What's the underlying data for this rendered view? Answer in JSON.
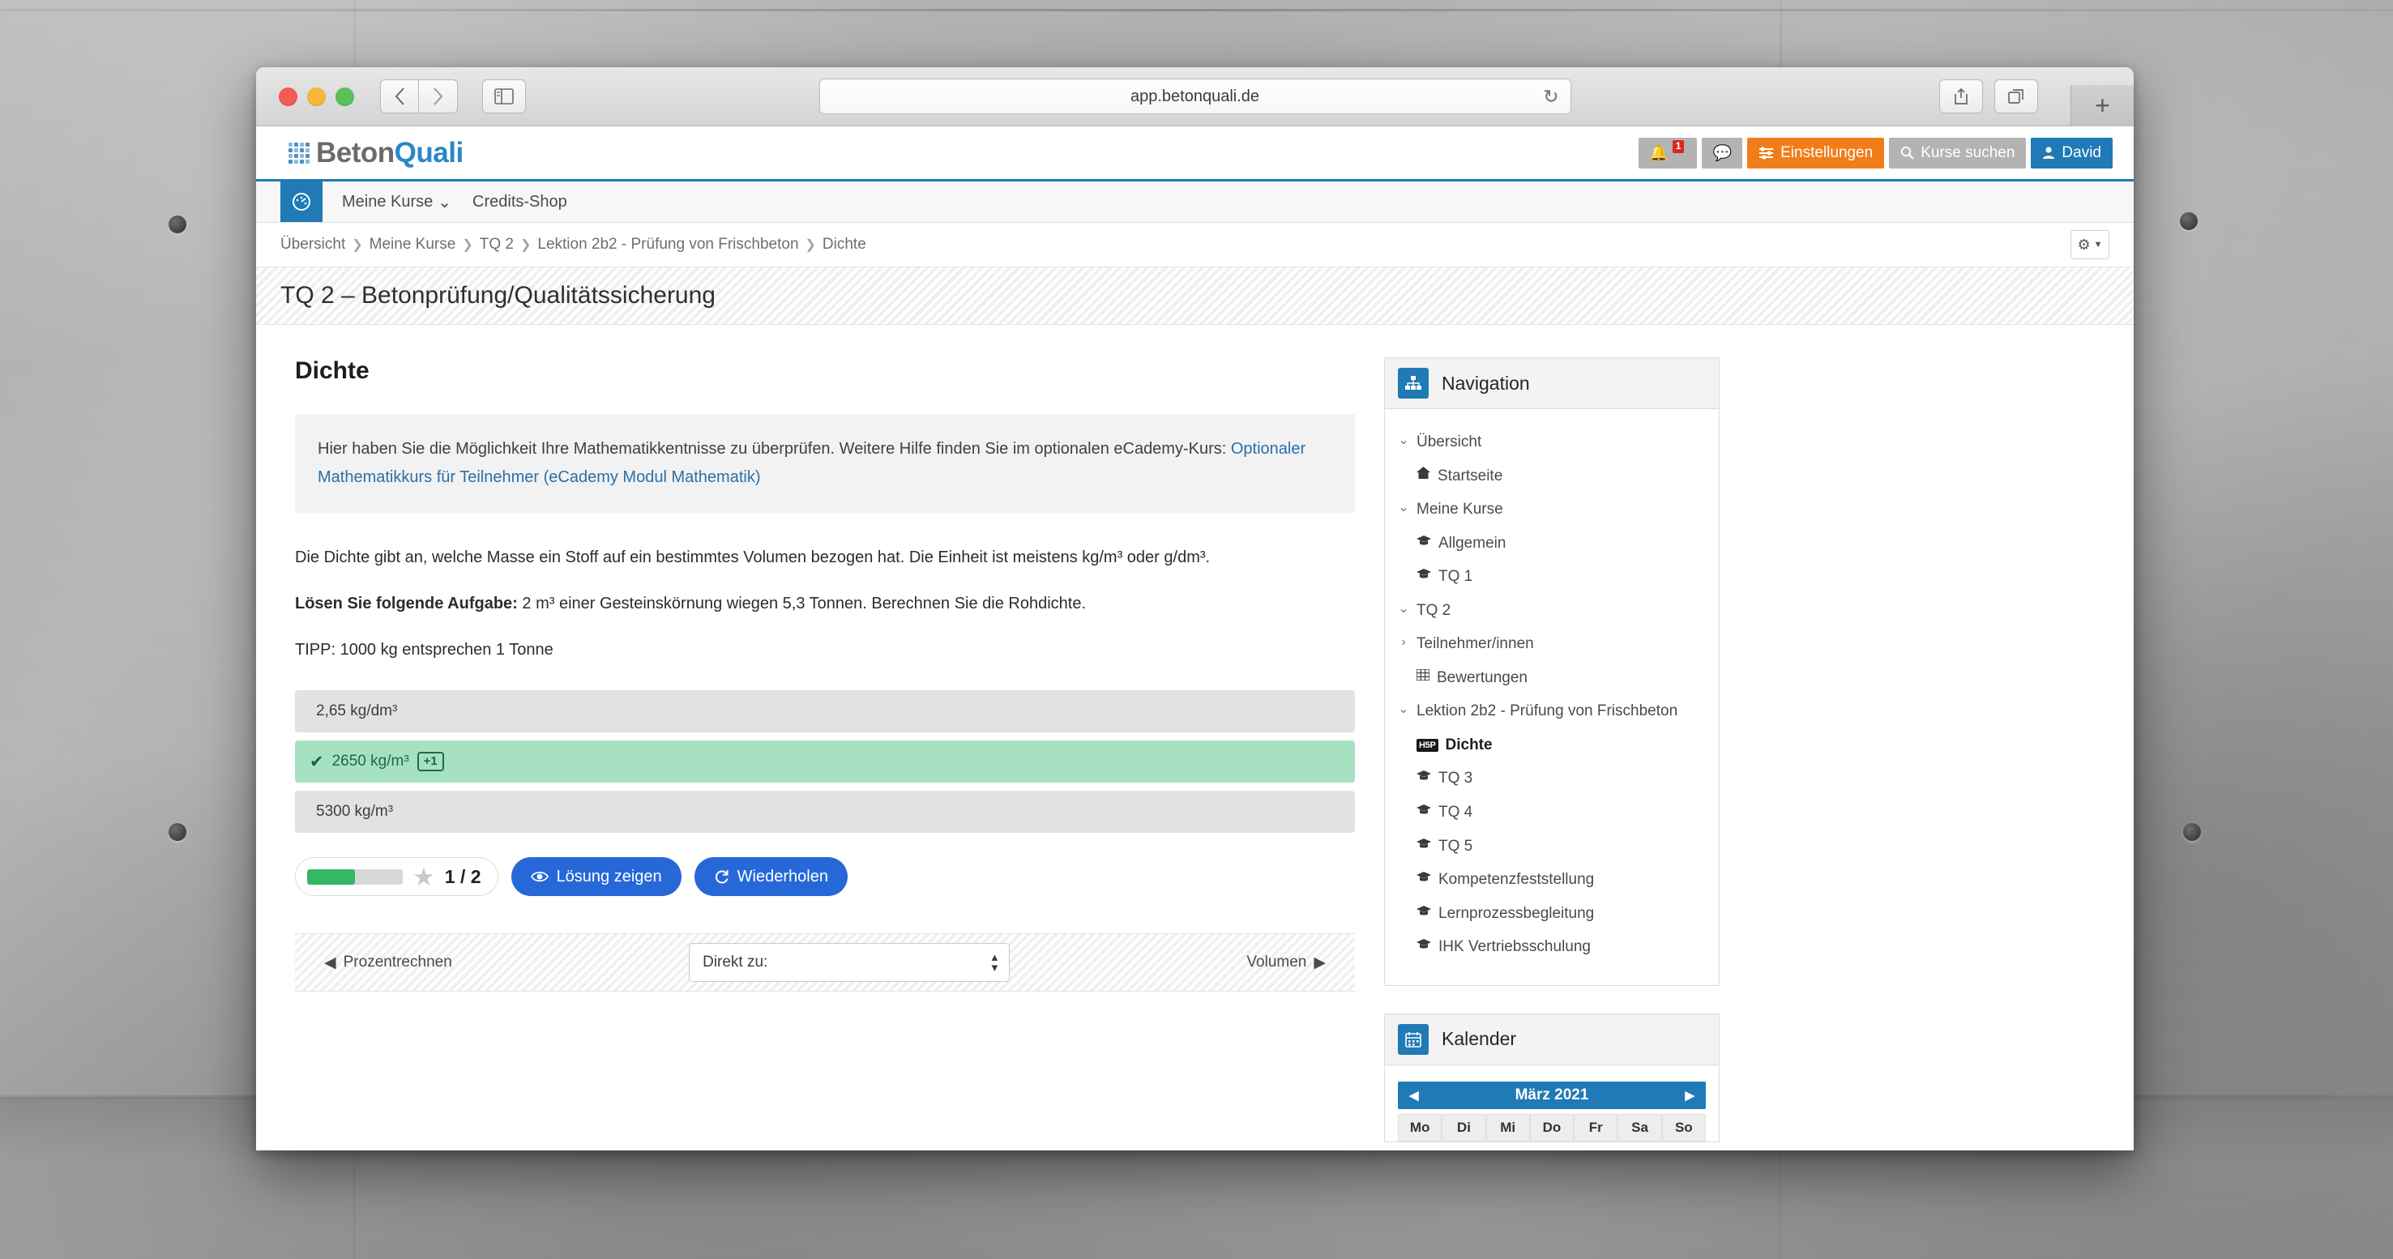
{
  "browser": {
    "url": "app.betonquali.de",
    "reload_icon": "reload-icon",
    "back_icon": "chevron-left-icon",
    "forward_icon": "chevron-right-icon",
    "sidebar_icon": "sidebar-toggle-icon",
    "share_icon": "share-icon",
    "tabs_icon": "show-tabs-icon",
    "new_tab_label": "+"
  },
  "site": {
    "logo_first": "Beton",
    "logo_second": "Quali",
    "header_actions": {
      "notifications_count": "1",
      "settings_label": "Einstellungen",
      "search_label": "Kurse suchen",
      "user_label": "David"
    },
    "navbar": {
      "home_icon": "dashboard-icon",
      "links": [
        {
          "label": "Meine Kurse",
          "caret": "⌄"
        },
        {
          "label": "Credits-Shop",
          "caret": ""
        }
      ]
    },
    "breadcrumb": [
      "Übersicht",
      "Meine Kurse",
      "TQ 2",
      "Lektion 2b2 - Prüfung von Frischbeton",
      "Dichte"
    ],
    "page_title": "TQ 2 – Betonprüfung/Qualitätssicherung"
  },
  "main": {
    "section_title": "Dichte",
    "info_text": "Hier haben Sie die Möglichkeit Ihre Mathematikkentnisse zu überprüfen. Weitere Hilfe finden Sie im optionalen eCademy-Kurs: ",
    "info_link": "Optionaler Mathematikkurs für Teilnehmer (eCademy Modul Mathematik)",
    "paragraph_1": "Die Dichte gibt an, welche Masse ein Stoff auf ein bestimmtes Volumen bezogen hat. Die Einheit ist meistens kg/m³ oder g/dm³.",
    "task_label": "Lösen Sie folgende Aufgabe:",
    "task_text": " 2 m³ einer Gesteinskörnung wiegen 5,3 Tonnen. Berechnen Sie die Rohdichte.",
    "tip_text": "TIPP: 1000 kg entsprechen 1 Tonne",
    "answers": [
      {
        "label": "2,65 kg/dm³",
        "correct": false,
        "points": ""
      },
      {
        "label": "2650 kg/m³",
        "correct": true,
        "points": "+1"
      },
      {
        "label": "5300 kg/m³",
        "correct": false,
        "points": ""
      }
    ],
    "score": {
      "value": "1 / 2",
      "progress_percent": 50,
      "star_icon": "star-icon"
    },
    "buttons": {
      "show_solution": "Lösung zeigen",
      "show_solution_icon": "eye-icon",
      "retry": "Wiederholen",
      "retry_icon": "refresh-icon"
    },
    "bottom_nav": {
      "prev_label": "Prozentrechnen",
      "next_label": "Volumen",
      "jump_label": "Direkt zu:"
    }
  },
  "sidebar": {
    "navigation": {
      "title": "Navigation",
      "icon": "sitemap-icon",
      "items": [
        {
          "label": "Übersicht",
          "indent": 1,
          "twisty": "⌄",
          "icon": "",
          "active": false
        },
        {
          "label": "Startseite",
          "indent": 2,
          "twisty": "",
          "icon": "home",
          "active": false
        },
        {
          "label": "Meine Kurse",
          "indent": 2,
          "twisty": "⌄",
          "icon": "",
          "active": false
        },
        {
          "label": "Allgemein",
          "indent": 2,
          "twisty": "",
          "icon": "cap",
          "active": false
        },
        {
          "label": "TQ 1",
          "indent": 2,
          "twisty": "",
          "icon": "cap",
          "active": false
        },
        {
          "label": "TQ 2",
          "indent": 3,
          "twisty": "⌄",
          "icon": "",
          "active": false
        },
        {
          "label": "Teilnehmer/innen",
          "indent": 4,
          "twisty": "›",
          "icon": "",
          "active": false
        },
        {
          "label": "Bewertungen",
          "indent": 4,
          "twisty": "",
          "icon": "grid",
          "active": false
        },
        {
          "label": "Lektion 2b2 - Prüfung von Frischbeton",
          "indent": 4,
          "twisty": "⌄",
          "icon": "",
          "active": false
        },
        {
          "label": "Dichte",
          "indent": 5,
          "twisty": "",
          "icon": "h5p",
          "active": true
        },
        {
          "label": "TQ 3",
          "indent": 2,
          "twisty": "",
          "icon": "cap",
          "active": false
        },
        {
          "label": "TQ 4",
          "indent": 2,
          "twisty": "",
          "icon": "cap",
          "active": false
        },
        {
          "label": "TQ 5",
          "indent": 2,
          "twisty": "",
          "icon": "cap",
          "active": false
        },
        {
          "label": "Kompetenzfeststellung",
          "indent": 2,
          "twisty": "",
          "icon": "cap",
          "active": false
        },
        {
          "label": "Lernprozessbegleitung",
          "indent": 2,
          "twisty": "",
          "icon": "cap",
          "active": false
        },
        {
          "label": "IHK Vertriebsschulung",
          "indent": 2,
          "twisty": "",
          "icon": "cap",
          "active": false
        }
      ]
    },
    "calendar": {
      "title": "Kalender",
      "icon": "calendar-icon",
      "month": "März 2021",
      "prev_icon": "triangle-left-icon",
      "next_icon": "triangle-right-icon",
      "weekdays": [
        "Mo",
        "Di",
        "Mi",
        "Do",
        "Fr",
        "Sa",
        "So"
      ]
    }
  },
  "colors": {
    "brand_blue": "#1f7ab5",
    "accent_orange": "#f07d1a",
    "button_blue": "#2668d8",
    "correct_green_bg": "#a6e2c2",
    "correct_green_text": "#17663f",
    "progress_green": "#35b864",
    "badge_red": "#d9281f"
  }
}
